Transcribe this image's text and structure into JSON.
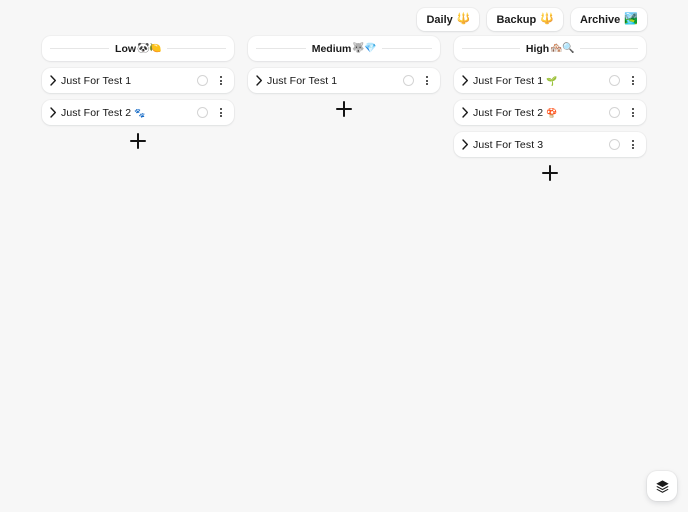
{
  "toolbar": {
    "buttons": [
      {
        "label": "Daily",
        "emoji": "🔱",
        "icon": "trident-icon"
      },
      {
        "label": "Backup",
        "emoji": "🔱",
        "icon": "trident-icon"
      },
      {
        "label": "Archive",
        "emoji": "🏞️",
        "icon": "landscape-icon"
      }
    ]
  },
  "board": {
    "columns": [
      {
        "id": "low",
        "title": "Low",
        "title_emoji": "🐼🍋",
        "add_label": "+",
        "cards": [
          {
            "title": "Just For Test 1",
            "emoji": ""
          },
          {
            "title": "Just For Test 2",
            "emoji": "🐾"
          }
        ]
      },
      {
        "id": "medium",
        "title": "Medium",
        "title_emoji": "🐺💎",
        "add_label": "+",
        "cards": [
          {
            "title": "Just For Test 1",
            "emoji": ""
          }
        ]
      },
      {
        "id": "high",
        "title": "High",
        "title_emoji": "🏘️🔍",
        "add_label": "+",
        "cards": [
          {
            "title": "Just For Test 1",
            "emoji": "🌱"
          },
          {
            "title": "Just For Test 2",
            "emoji": "🍄"
          },
          {
            "title": "Just For Test 3",
            "emoji": ""
          }
        ]
      }
    ]
  },
  "fab": {
    "icon": "layers-icon"
  },
  "colors": {
    "background": "#f7f7f7",
    "surface": "#ffffff",
    "text": "#141414",
    "rule": "#e6e6e6",
    "circle_border": "#d4d4d4"
  }
}
